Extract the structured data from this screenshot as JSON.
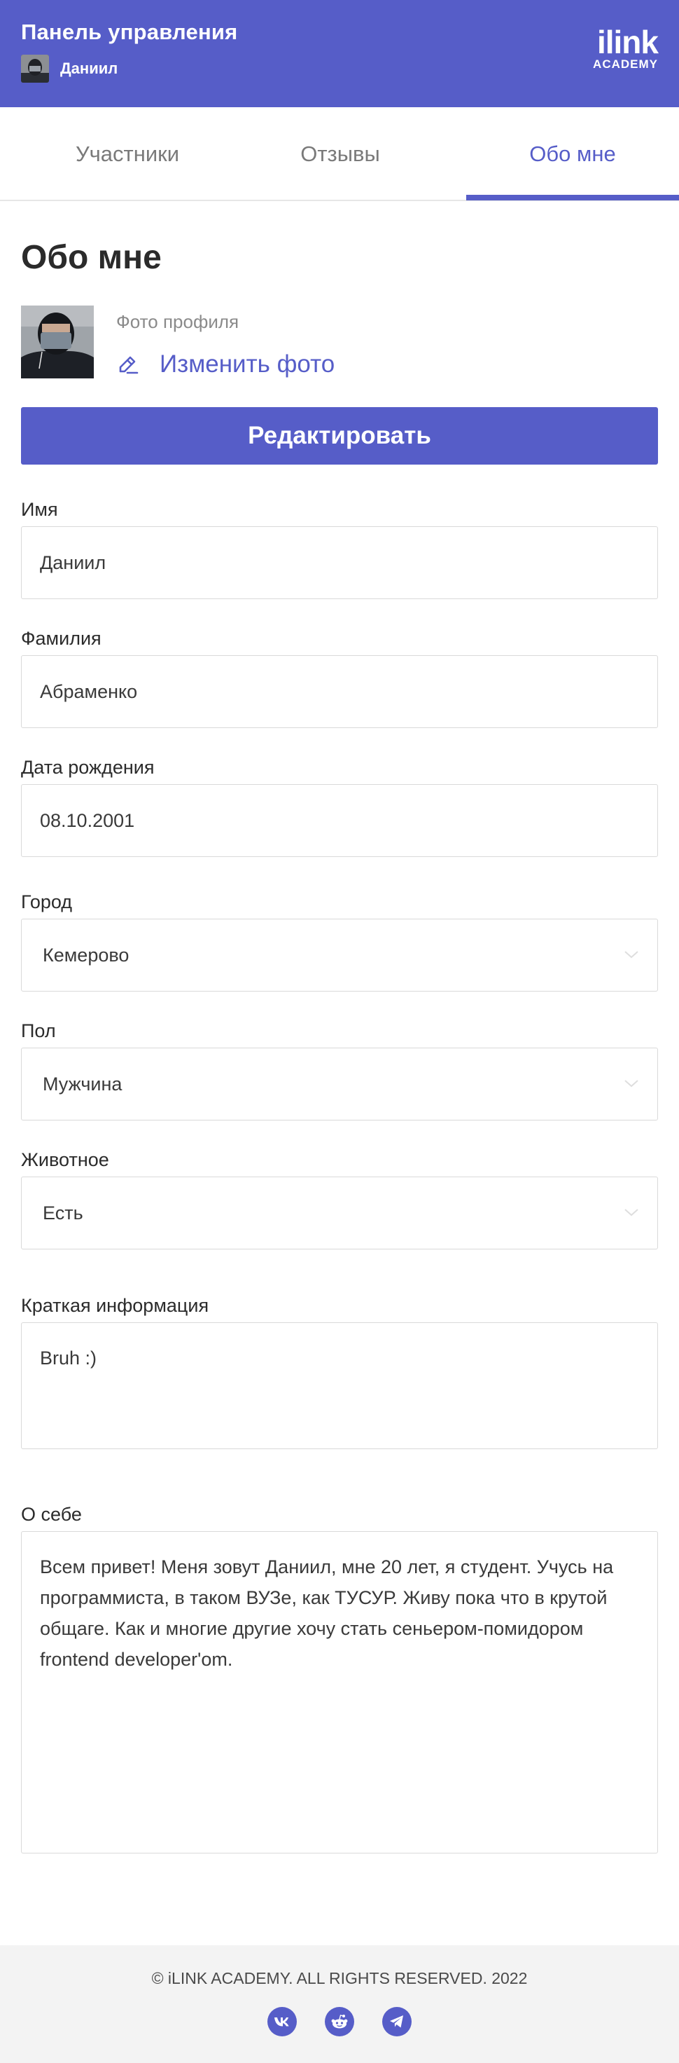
{
  "header": {
    "title": "Панель управления",
    "username": "Даниил",
    "logo_main": "ilink",
    "logo_sub": "ACADEMY"
  },
  "tabs": [
    {
      "label": "Участники",
      "active": false
    },
    {
      "label": "Отзывы",
      "active": false
    },
    {
      "label": "Обо мне",
      "active": true
    }
  ],
  "main": {
    "title": "Обо мне",
    "photo_caption": "Фото профиля",
    "change_photo_label": "Изменить фото",
    "edit_button_label": "Редактировать"
  },
  "fields": {
    "first_name": {
      "label": "Имя",
      "value": "Даниил"
    },
    "last_name": {
      "label": "Фамилия",
      "value": "Абраменко"
    },
    "birth_date": {
      "label": "Дата рождения",
      "value": "08.10.2001"
    },
    "city": {
      "label": "Город",
      "value": "Кемерово"
    },
    "gender": {
      "label": "Пол",
      "value": "Мужчина"
    },
    "pet": {
      "label": "Животное",
      "value": "Есть"
    },
    "short_info": {
      "label": "Краткая информация",
      "value": "Bruh :)"
    },
    "about": {
      "label": "О себе",
      "value": "Всем привет! Меня зовут Даниил, мне 20 лет, я студент. Учусь на программиста, в таком ВУЗе, как ТУСУР. Живу пока что в крутой общаге. Как и многие другие хочу стать сеньером-помидором frontend developer'om."
    }
  },
  "footer": {
    "copyright": "© iLINK ACADEMY. ALL RIGHTS RESERVED. 2022",
    "social": [
      "vk-icon",
      "reddit-icon",
      "telegram-icon"
    ]
  },
  "colors": {
    "accent": "#565dc8",
    "footer_bg": "#f3f3f3",
    "border": "#d9d9d9"
  }
}
